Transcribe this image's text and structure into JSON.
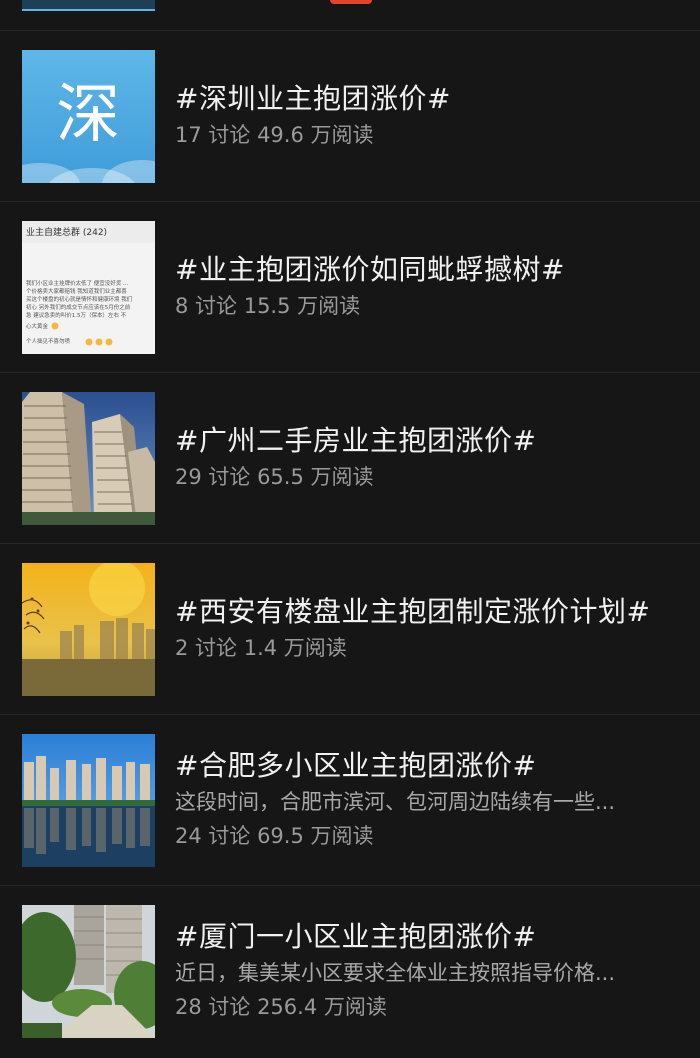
{
  "topics": [
    {
      "title": "#深圳业主抱团涨价#",
      "desc": "",
      "meta": "17 讨论 49.6 万阅读",
      "thumb_icon": "shen-character-thumbnail",
      "thumb_char": "深"
    },
    {
      "title": "#业主抱团涨价如同蚍蜉撼树#",
      "desc": "",
      "meta": "8 讨论 15.5 万阅读",
      "thumb_icon": "chat-screenshot-thumbnail",
      "chat": {
        "header": "业主自建总群 (242)",
        "lines": [
          "我们小区业主挂牌价太低了 便宜没好货 ...",
          "个价格卖大家都赔钱 我知道我们业主都喜",
          "买这个楼盘的初心就是情怀和健康环境 我们",
          "初心 另外我们的成交节点应该在5月份之前",
          "急 建议急卖的叫价1.5万（保本）左右 不",
          "心大黄金",
          "个人拙见不喜勿喷"
        ]
      }
    },
    {
      "title": "#广州二手房业主抱团涨价#",
      "desc": "",
      "meta": "29 讨论 65.5 万阅读",
      "thumb_icon": "high-rise-building-thumbnail"
    },
    {
      "title": "#西安有楼盘业主抱团制定涨价计划#",
      "desc": "",
      "meta": "2 讨论 1.4 万阅读",
      "thumb_icon": "sunset-skyline-thumbnail"
    },
    {
      "title": "#合肥多小区业主抱团涨价#",
      "desc": "这段时间，合肥市滨河、包河周边陆续有一些...",
      "meta": "24 讨论 69.5 万阅读",
      "thumb_icon": "riverside-buildings-thumbnail"
    },
    {
      "title": "#厦门一小区业主抱团涨价#",
      "desc": "近日，集美某小区要求全体业主按照指导价格...",
      "meta": "28 讨论 256.4 万阅读",
      "thumb_icon": "residential-garden-thumbnail"
    }
  ]
}
